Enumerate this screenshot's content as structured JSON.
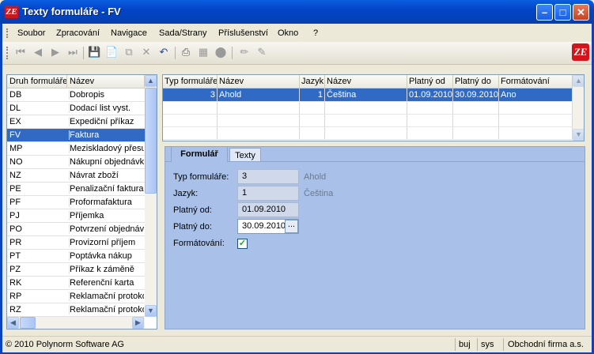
{
  "window": {
    "title": "Texty formuláře - FV"
  },
  "menu": [
    "Soubor",
    "Zpracování",
    "Navigace",
    "Sada/Strany",
    "Příslušenství",
    "Okno",
    "?"
  ],
  "toolbar": {
    "logo_text": "ZE"
  },
  "left_list": {
    "headers": [
      "Druh formuláře",
      "Název"
    ],
    "rows": [
      [
        "DB",
        "Dobropis"
      ],
      [
        "DL",
        "Dodací list vyst."
      ],
      [
        "EX",
        "Expediční příkaz"
      ],
      [
        "FV",
        "Faktura"
      ],
      [
        "MP",
        "Meziskladový přesun"
      ],
      [
        "NO",
        "Nákupní objednávka"
      ],
      [
        "NZ",
        "Návrat zboží"
      ],
      [
        "PE",
        "Penalizační faktura"
      ],
      [
        "PF",
        "Proformafaktura"
      ],
      [
        "PJ",
        "Příjemka"
      ],
      [
        "PO",
        "Potvrzení objednávky"
      ],
      [
        "PR",
        "Provizorní příjem"
      ],
      [
        "PT",
        "Poptávka nákup"
      ],
      [
        "PZ",
        "Příkaz k záměně"
      ],
      [
        "RK",
        "Referenční karta"
      ],
      [
        "RP",
        "Reklamační protokol"
      ],
      [
        "RZ",
        "Reklamační protokol"
      ]
    ],
    "selected_index": 3
  },
  "grid": {
    "headers": [
      "Typ formuláře",
      "Název",
      "Jazyk",
      "Název",
      "Platný od",
      "Platný do",
      "Formátování"
    ],
    "row": [
      "3",
      "Ahold",
      "1",
      "Čeština",
      "01.09.2010",
      "30.09.2010",
      "Ano"
    ]
  },
  "tabs": [
    "Formulář",
    "Texty"
  ],
  "form": {
    "typ_label": "Typ formuláře:",
    "typ_value": "3",
    "typ_name": "Ahold",
    "jazyk_label": "Jazyk:",
    "jazyk_value": "1",
    "jazyk_name": "Čeština",
    "od_label": "Platný od:",
    "od_value": "01.09.2010",
    "do_label": "Platný do:",
    "do_value": "30.09.2010",
    "format_label": "Formátování:",
    "format_checked": true,
    "dots": "..."
  },
  "status": {
    "copyright": "© 2010 Polynorm Software AG",
    "user": "buj",
    "db": "sys",
    "company": "Obchodní firma a.s."
  }
}
